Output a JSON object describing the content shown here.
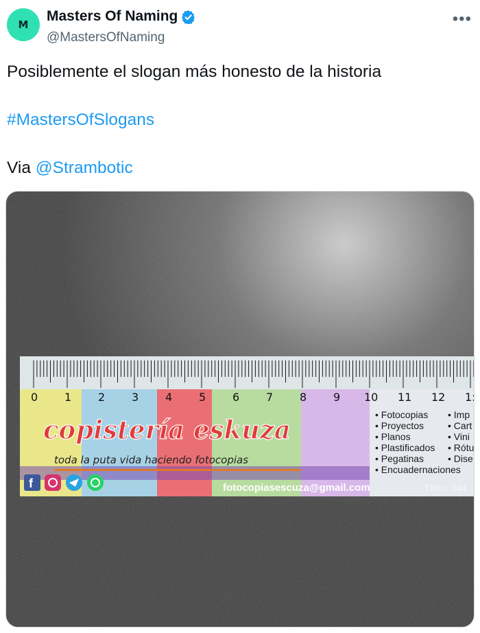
{
  "account": {
    "display_name": "Masters Of Naming",
    "handle": "@MastersOfNaming",
    "avatar_letter": "M",
    "verified": true
  },
  "tweet": {
    "text": "Posiblemente el slogan más honesto de la historia",
    "hashtag": "#MastersOfSlogans",
    "via_label": "Via",
    "via_mention": "@Strambotic"
  },
  "colors": {
    "link": "#1d9bf0",
    "avatar": "#2fe0b3",
    "verified": "#1d9bf0"
  },
  "photo": {
    "ruler_numbers": [
      "0",
      "1",
      "2",
      "3",
      "4",
      "5",
      "6",
      "7",
      "8",
      "9",
      "10",
      "11",
      "12",
      "1:"
    ],
    "brand": "copistería eskuza",
    "slogan": "toda la puta vida haciendo fotocopias",
    "services_col1": [
      "• Fotocopias",
      "• Proyectos",
      "• Planos",
      "• Plastificados",
      "• Pegatinas",
      "• Encuadernaciones"
    ],
    "services_col2": [
      "• Imp",
      "• Cart",
      "• Vini",
      "• Rótu",
      "• Dise"
    ],
    "email": "fotocopiasescuza@gmail.com",
    "phone": "Tfno.: 944"
  }
}
